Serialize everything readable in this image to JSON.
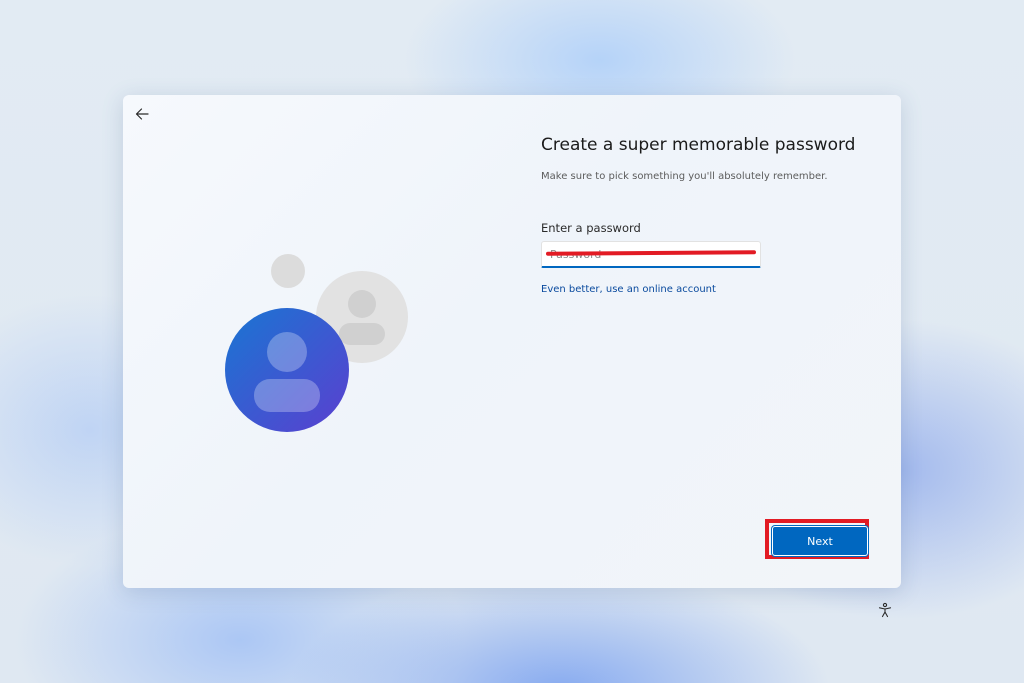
{
  "setup": {
    "back_icon": "arrow-left-icon",
    "title": "Create a super memorable password",
    "subtitle": "Make sure to pick something you'll absolutely remember.",
    "field_label": "Enter a password",
    "password_placeholder": "Password",
    "password_value": "",
    "online_account_link": "Even better, use an online account",
    "next_label": "Next",
    "accessibility_icon": "accessibility-icon",
    "illustration_icon": "user-accounts-illustration"
  },
  "colors": {
    "accent": "#0067c0",
    "link": "#0a4a9e",
    "annotation_red": "#e21b24",
    "avatar_gradient_start": "#1976d2",
    "avatar_gradient_end": "#5b3fd0"
  }
}
